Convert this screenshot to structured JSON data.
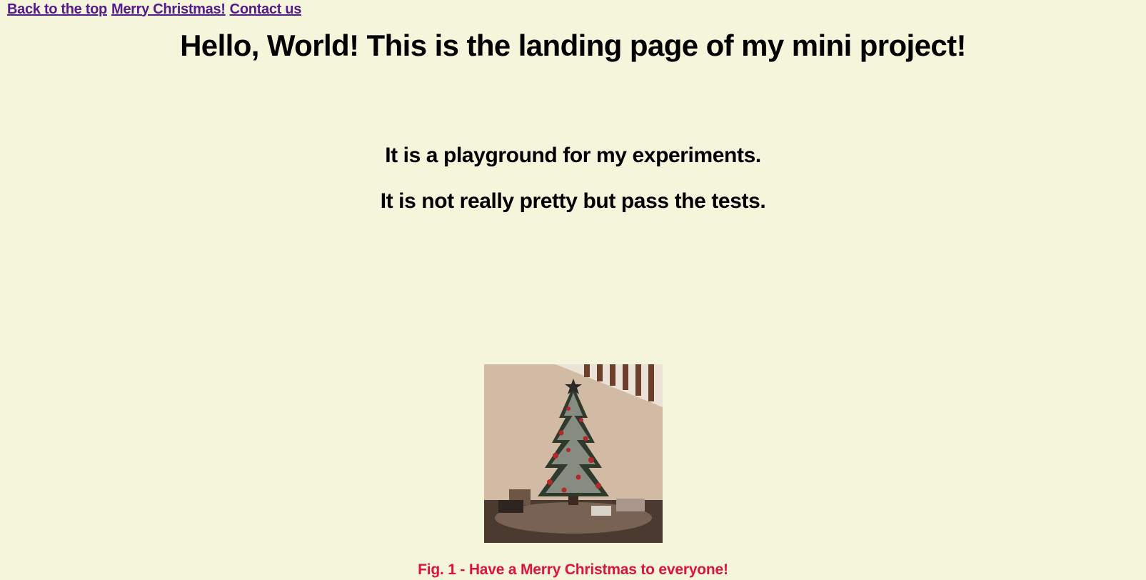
{
  "nav": {
    "links": [
      "Back to the top",
      "Merry Christmas!",
      "Contact us"
    ]
  },
  "header": {
    "title": "Hello, World! This is the landing page of my mini project!"
  },
  "main": {
    "lines": [
      "It is a playground for my experiments.",
      "It is not really pretty but pass the tests."
    ]
  },
  "figure": {
    "caption": "Fig. 1 - Have a Merry Christmas to everyone!"
  },
  "colors": {
    "background": "#f5f5dc",
    "link": "#551a8b",
    "caption": "#dc143c"
  }
}
